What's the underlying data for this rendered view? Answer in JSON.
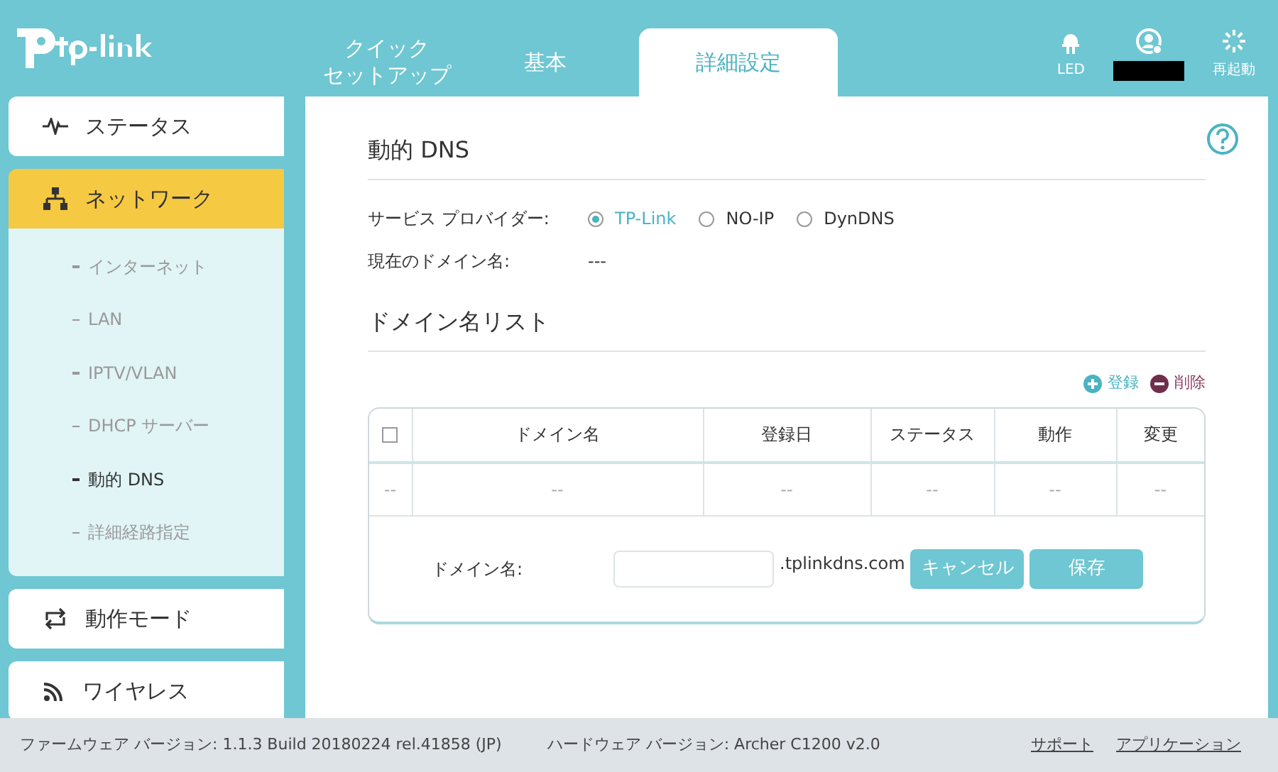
{
  "header": {
    "tabs": [
      {
        "lines": [
          "クイック",
          "セットアップ"
        ],
        "selected": false
      },
      {
        "lines": [
          "基本"
        ],
        "selected": false
      },
      {
        "lines": [
          "詳細設定"
        ],
        "selected": true
      }
    ],
    "actions": [
      {
        "kind": "led",
        "label": "LED"
      },
      {
        "kind": "account_redacted"
      },
      {
        "kind": "reboot",
        "label": "再起動"
      }
    ]
  },
  "sidebar": {
    "items": [
      {
        "kind": "status",
        "label": "ステータス",
        "selected": false
      },
      {
        "kind": "network",
        "label": "ネットワーク",
        "selected": true,
        "children": [
          {
            "label": "インターネット",
            "selected": false
          },
          {
            "label": "LAN",
            "selected": false
          },
          {
            "label": "IPTV/VLAN",
            "selected": false
          },
          {
            "label": "DHCP サーバー",
            "selected": false
          },
          {
            "label": "動的 DNS",
            "selected": true
          },
          {
            "label": "詳細経路指定",
            "selected": false
          }
        ]
      },
      {
        "kind": "mode",
        "label": "動作モード",
        "selected": false
      },
      {
        "kind": "wireless",
        "label": "ワイヤレス",
        "selected": false
      }
    ]
  },
  "main": {
    "title": "動的 DNS",
    "provider_label": "サービス プロバイダー:",
    "providers": [
      {
        "label": "TP-Link",
        "selected": true
      },
      {
        "label": "NO-IP",
        "selected": false
      },
      {
        "label": "DynDNS",
        "selected": false
      }
    ],
    "current_domain_label": "現在のドメイン名:",
    "current_domain_value": "---",
    "list_title": "ドメイン名リスト",
    "add_label": "登録",
    "delete_label": "削除",
    "table": {
      "columns": [
        "",
        "ドメイン名",
        "登録日",
        "ステータス",
        "動作",
        "変更"
      ],
      "header_checked": false,
      "rows": [
        [
          "--",
          "--",
          "--",
          "--",
          "--",
          "--"
        ]
      ]
    },
    "form": {
      "label": "ドメイン名:",
      "suffix": ".tplinkdns.com",
      "cancel": "キャンセル",
      "save": "保存"
    }
  },
  "footer": {
    "firmware": "ファームウェア バージョン: 1.1.3 Build 20180224 rel.41858 (JP)",
    "hardware": "ハードウェア バージョン: Archer C1200 v2.0",
    "links": [
      "サポート",
      "アプリケーション"
    ]
  }
}
